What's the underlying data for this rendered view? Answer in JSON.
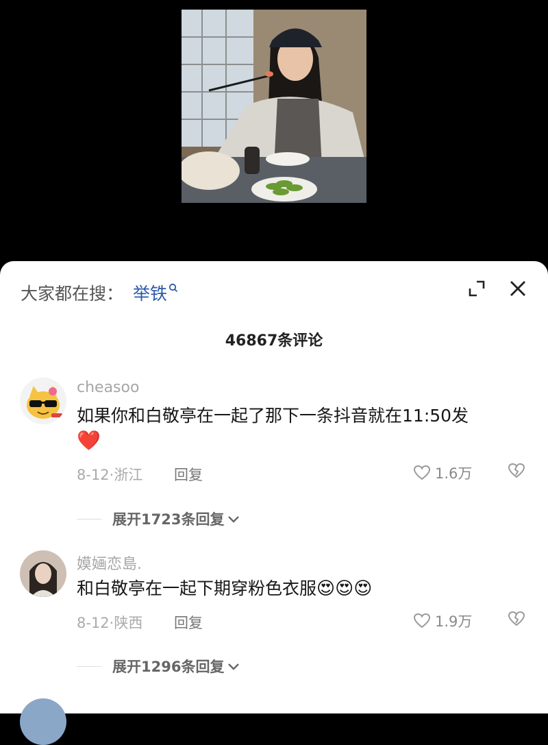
{
  "search": {
    "prefix": "大家都在搜：",
    "term": "举铁"
  },
  "comments_count_label": "46867条评论",
  "comments": [
    {
      "username": "cheasoo",
      "text": "如果你和白敬亭在一起了那下一条抖音就在11:50发",
      "emoji": "❤️",
      "meta": "8-12·浙江",
      "reply_label": "回复",
      "likes": "1.6万",
      "expand_label": "展开1723条回复"
    },
    {
      "username": "嫫婳恋島.",
      "text": "和白敬亭在一起下期穿粉色衣服",
      "emoji": "😍😍😍",
      "meta": "8-12·陕西",
      "reply_label": "回复",
      "likes": "1.9万",
      "expand_label": "展开1296条回复"
    }
  ],
  "icons": {
    "expand": "expand-icon",
    "close": "close-icon",
    "heart": "heart-outline-icon",
    "dislike": "broken-heart-icon",
    "chevron": "chevron-down-icon"
  },
  "colors": {
    "link": "#2a5aa8",
    "heart_emoji": "#e8323c"
  }
}
